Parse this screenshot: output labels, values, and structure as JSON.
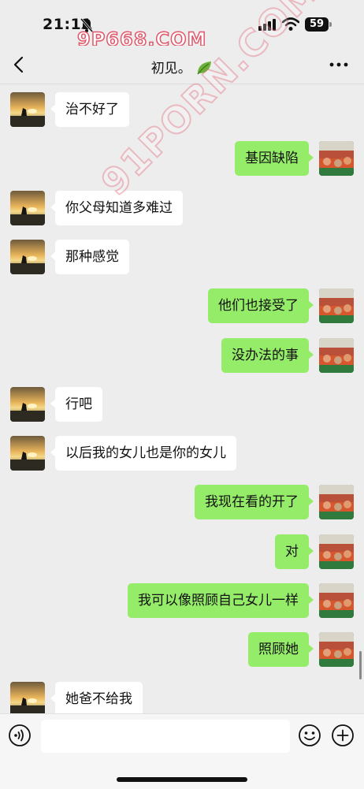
{
  "status_bar": {
    "time": "21:11",
    "battery": "59",
    "icons": [
      "bell-slash-icon",
      "signal-icon",
      "wifi-icon",
      "battery-icon"
    ]
  },
  "watermark": {
    "top": "9P668.COM",
    "diagonal": "91PORN.COM"
  },
  "header": {
    "title": "初见。",
    "title_icon": "leaf-icon",
    "back_icon": "chevron-left-icon",
    "more_icon": "more-dots-icon"
  },
  "messages": [
    {
      "side": "left",
      "text": "治不好了"
    },
    {
      "side": "right",
      "text": "基因缺陷"
    },
    {
      "side": "left",
      "text": "你父母知道多难过"
    },
    {
      "side": "left",
      "text": "那种感觉"
    },
    {
      "side": "right",
      "text": "他们也接受了"
    },
    {
      "side": "right",
      "text": "没办法的事"
    },
    {
      "side": "left",
      "text": "行吧"
    },
    {
      "side": "left",
      "text": "以后我的女儿也是你的女儿"
    },
    {
      "side": "right",
      "text": "我现在看的开了"
    },
    {
      "side": "right",
      "text": "对"
    },
    {
      "side": "right",
      "text": "我可以像照顾自己女儿一样"
    },
    {
      "side": "right",
      "text": "照顾她"
    },
    {
      "side": "left",
      "text": "她爸不给我"
    }
  ],
  "input_bar": {
    "text": "",
    "icons": [
      "voice-icon",
      "emoji-icon",
      "plus-icon"
    ]
  },
  "colors": {
    "background": "#ededed",
    "bubble_self": "#95ec69",
    "bubble_other": "#ffffff",
    "watermark": "#e0576a"
  }
}
